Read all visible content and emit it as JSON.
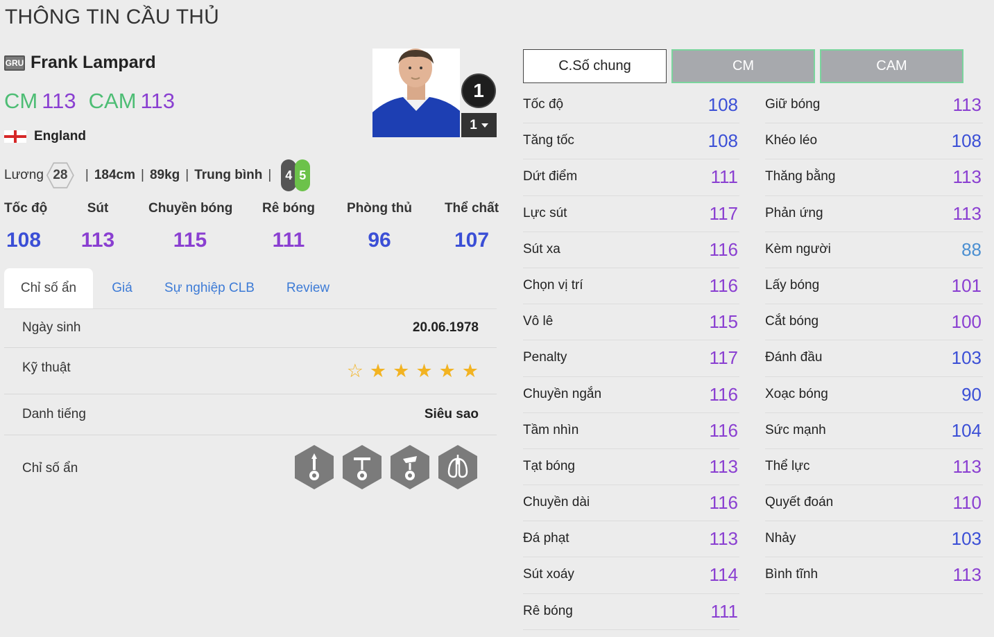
{
  "page": {
    "title": "THÔNG TIN CẦU THỦ"
  },
  "player": {
    "season": "GRU",
    "name": "Frank Lampard",
    "positions": [
      {
        "pos": "CM",
        "ovr": "113"
      },
      {
        "pos": "CAM",
        "ovr": "113"
      }
    ],
    "nation": "England",
    "salary_label": "Lương",
    "salary": "28",
    "height": "184cm",
    "weight": "89kg",
    "body_type": "Trung bình",
    "weak_foot": "4",
    "strong_foot": "5",
    "upgrade_level": "1",
    "upgrade_select": "1"
  },
  "main_stats": [
    {
      "label": "Tốc độ",
      "value": "108",
      "color": "#3b4fd6"
    },
    {
      "label": "Sút",
      "value": "113",
      "color": "#8a3fd1"
    },
    {
      "label": "Chuyền bóng",
      "value": "115",
      "color": "#8a3fd1"
    },
    {
      "label": "Rê bóng",
      "value": "111",
      "color": "#8a3fd1"
    },
    {
      "label": "Phòng thủ",
      "value": "96",
      "color": "#3b4fd6"
    },
    {
      "label": "Thể chất",
      "value": "107",
      "color": "#3b4fd6"
    }
  ],
  "tabs": [
    "Chỉ số ẩn",
    "Giá",
    "Sự nghiệp CLB",
    "Review"
  ],
  "info": {
    "birth_label": "Ngày sinh",
    "birth": "20.06.1978",
    "skill_label": "Kỹ thuật",
    "skill_stars": 5,
    "rep_label": "Danh tiếng",
    "rep": "Siêu sao",
    "hidden_label": "Chỉ số ẩn",
    "hidden_icons": [
      "long-shot-taker-icon",
      "finesse-shot-icon",
      "playmaker-icon",
      "stamina-lungs-icon"
    ]
  },
  "stat_tabs": [
    "C.Số chung",
    "CM",
    "CAM"
  ],
  "attributes_left": [
    {
      "name": "Tốc độ",
      "value": "108",
      "color": "#3b4fd6"
    },
    {
      "name": "Tăng tốc",
      "value": "108",
      "color": "#3b4fd6"
    },
    {
      "name": "Dứt điểm",
      "value": "111",
      "color": "#8a3fd1"
    },
    {
      "name": "Lực sút",
      "value": "117",
      "color": "#8a3fd1"
    },
    {
      "name": "Sút xa",
      "value": "116",
      "color": "#8a3fd1"
    },
    {
      "name": "Chọn vị trí",
      "value": "116",
      "color": "#8a3fd1"
    },
    {
      "name": "Vô lê",
      "value": "115",
      "color": "#8a3fd1"
    },
    {
      "name": "Penalty",
      "value": "117",
      "color": "#8a3fd1"
    },
    {
      "name": "Chuyền ngắn",
      "value": "116",
      "color": "#8a3fd1"
    },
    {
      "name": "Tầm nhìn",
      "value": "116",
      "color": "#8a3fd1"
    },
    {
      "name": "Tạt bóng",
      "value": "113",
      "color": "#8a3fd1"
    },
    {
      "name": "Chuyền dài",
      "value": "116",
      "color": "#8a3fd1"
    },
    {
      "name": "Đá phạt",
      "value": "113",
      "color": "#8a3fd1"
    },
    {
      "name": "Sút xoáy",
      "value": "114",
      "color": "#8a3fd1"
    },
    {
      "name": "Rê bóng",
      "value": "111",
      "color": "#8a3fd1"
    }
  ],
  "attributes_right": [
    {
      "name": "Giữ bóng",
      "value": "113",
      "color": "#8a3fd1"
    },
    {
      "name": "Khéo léo",
      "value": "108",
      "color": "#3b4fd6"
    },
    {
      "name": "Thăng bằng",
      "value": "113",
      "color": "#8a3fd1"
    },
    {
      "name": "Phản ứng",
      "value": "113",
      "color": "#8a3fd1"
    },
    {
      "name": "Kèm người",
      "value": "88",
      "color": "#4b8fd1"
    },
    {
      "name": "Lấy bóng",
      "value": "101",
      "color": "#8a3fd1"
    },
    {
      "name": "Cắt bóng",
      "value": "100",
      "color": "#8a3fd1"
    },
    {
      "name": "Đánh đầu",
      "value": "103",
      "color": "#3b4fd6"
    },
    {
      "name": "Xoạc bóng",
      "value": "90",
      "color": "#3b4fd6"
    },
    {
      "name": "Sức mạnh",
      "value": "104",
      "color": "#3b4fd6"
    },
    {
      "name": "Thể lực",
      "value": "113",
      "color": "#8a3fd1"
    },
    {
      "name": "Quyết đoán",
      "value": "110",
      "color": "#8a3fd1"
    },
    {
      "name": "Nhảy",
      "value": "103",
      "color": "#3b4fd6"
    },
    {
      "name": "Bình tĩnh",
      "value": "113",
      "color": "#8a3fd1"
    }
  ]
}
